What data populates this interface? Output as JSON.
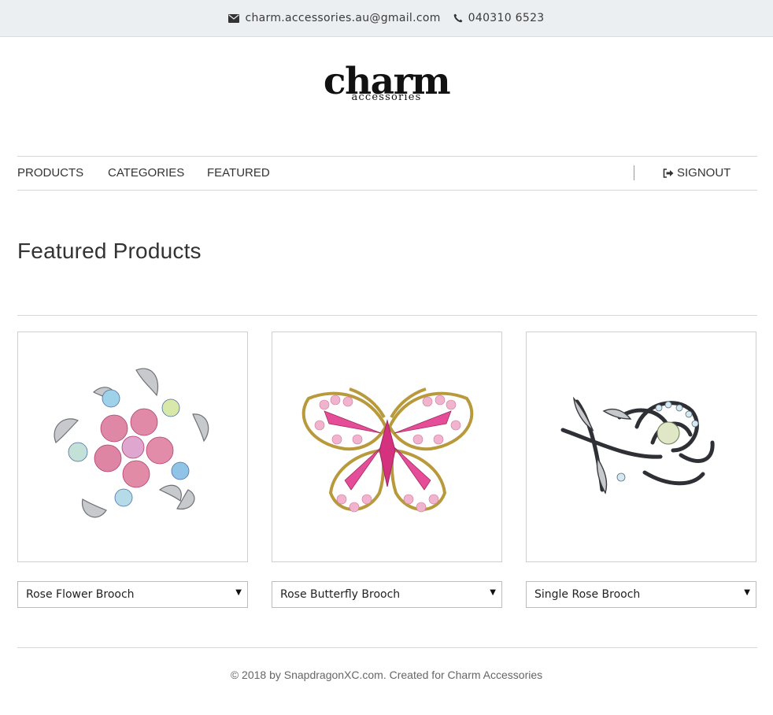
{
  "header": {
    "email": "charm.accessories.au@gmail.com",
    "phone": "040310 6523",
    "email_icon": "envelope-icon",
    "phone_icon": "phone-icon"
  },
  "logo": {
    "word": "charm",
    "sub": "accessories"
  },
  "nav": {
    "items": [
      "PRODUCTS",
      "CATEGORIES",
      "FEATURED"
    ],
    "signout": "SIGNOUT",
    "signout_icon": "sign-out-icon"
  },
  "main": {
    "title": "Featured Products",
    "products": [
      {
        "name": "Rose Flower Brooch",
        "image_icon": "flower-brooch-image"
      },
      {
        "name": "Rose Butterfly Brooch",
        "image_icon": "butterfly-brooch-image"
      },
      {
        "name": "Single Rose Brooch",
        "image_icon": "rose-brooch-image"
      }
    ]
  },
  "footer": {
    "text": "© 2018 by SnapdragonXC.com. Created for Charm Accessories"
  },
  "colors": {
    "topbar_bg": "#eceff2",
    "text": "#333333",
    "rule": "#d6d6d6"
  }
}
